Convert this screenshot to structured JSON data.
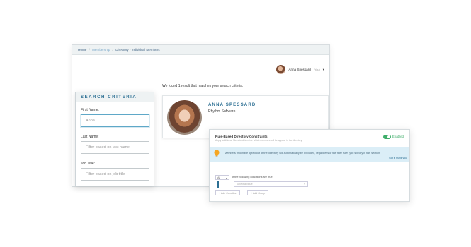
{
  "breadcrumb": {
    "home": "Home",
    "membership": "Membership",
    "current": "Directory - Individual Members"
  },
  "user": {
    "name": "Anna Spessard",
    "role": "(You)"
  },
  "results": {
    "summary": "We found 1 result that matches your search criteria."
  },
  "member": {
    "name": "ANNA SPESSARD",
    "company": "Rhythm Software"
  },
  "search": {
    "title": "SEARCH CRITERIA",
    "first_name_label": "First Name:",
    "first_name_value": "Anna",
    "last_name_label": "Last Name:",
    "last_name_placeholder": "Filter based on last name",
    "job_title_label": "Job Title:",
    "job_title_placeholder": "Filter based on job title"
  },
  "rules": {
    "title": "Rule-Based Directory Constraints",
    "subtitle": "Apply additional filters to determine which members will be appear in the directory",
    "toggle_label": "Enabled",
    "info_text": "Members who have opted out of the directory will automatically be excluded, regardless of the filter rules you specify in this section.",
    "info_link": "Got it, thank you",
    "match_select": "All",
    "match_text": "of the following conditions are true",
    "value_placeholder": "Select a value",
    "add_condition": "+ Add Condition",
    "add_group": "+ Add Group"
  },
  "colors": {
    "accent": "#2c6f93",
    "toggle_on": "#3fae6a",
    "info_bg": "#dbeef7"
  }
}
